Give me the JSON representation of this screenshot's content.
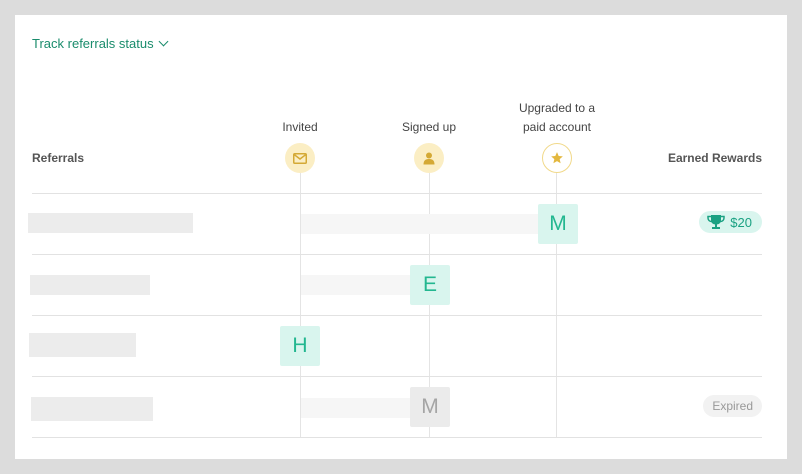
{
  "header": {
    "track_link": "Track referrals status",
    "referrals_label": "Referrals",
    "earned_rewards_label": "Earned Rewards"
  },
  "stages": [
    {
      "label": "Invited",
      "icon": "envelope-icon"
    },
    {
      "label": "Signed up",
      "icon": "person-icon"
    },
    {
      "label": "Upgraded to a paid account",
      "icon": "star-icon"
    }
  ],
  "rows": [
    {
      "initial": "M",
      "stage": "Upgraded to a paid account",
      "reward": "$20",
      "reward_icon": "trophy-icon",
      "status": "active"
    },
    {
      "initial": "E",
      "stage": "Signed up",
      "reward": "",
      "status": "active"
    },
    {
      "initial": "H",
      "stage": "Invited",
      "reward": "",
      "status": "active"
    },
    {
      "initial": "M",
      "stage": "Signed up",
      "reward": "Expired",
      "status": "expired"
    }
  ],
  "colors": {
    "accent": "#1a8c6c",
    "badge_green_bg": "#d9f5ee",
    "badge_green_text": "#23b790",
    "icon_bg": "#fbeec4",
    "icon_fg": "#d4a935"
  }
}
